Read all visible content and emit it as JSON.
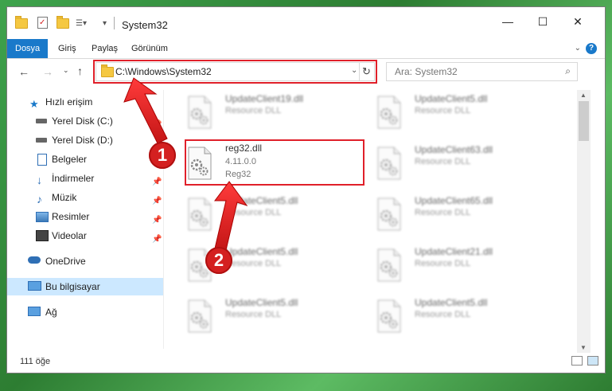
{
  "window": {
    "title": "System32",
    "minimize": "—",
    "maximize": "☐",
    "close": "✕"
  },
  "ribbon": {
    "tabs": [
      "Dosya",
      "Giriş",
      "Paylaş",
      "Görünüm"
    ],
    "help": "?"
  },
  "address": {
    "path": "C:\\Windows\\System32",
    "search_placeholder": "Ara: System32"
  },
  "nav": {
    "items": [
      {
        "label": "Hızlı erişim",
        "icon": "star-icon"
      },
      {
        "label": "Yerel Disk (C:)",
        "icon": "drive-icon"
      },
      {
        "label": "Yerel Disk (D:)",
        "icon": "drive-icon"
      },
      {
        "label": "Belgeler",
        "icon": "documents-icon"
      },
      {
        "label": "İndirmeler",
        "icon": "download-icon"
      },
      {
        "label": "Müzik",
        "icon": "music-icon"
      },
      {
        "label": "Resimler",
        "icon": "pictures-icon"
      },
      {
        "label": "Videolar",
        "icon": "video-icon"
      },
      {
        "label": "OneDrive",
        "icon": "cloud-icon"
      },
      {
        "label": "Bu bilgisayar",
        "icon": "computer-icon"
      },
      {
        "label": "Ağ",
        "icon": "network-icon"
      }
    ]
  },
  "files": {
    "left": [
      {
        "name": "UpdateClient19.dll",
        "type": "Resource DLL"
      },
      {
        "name": "reg32.dll",
        "type": "4.11.0.0",
        "extra": "Reg32"
      },
      {
        "name": "UpdateClient5.dll",
        "type": "Resource DLL"
      },
      {
        "name": "UpdateClient5.dll",
        "type": "Resource DLL"
      },
      {
        "name": "UpdateClient5.dll",
        "type": "Resource DLL"
      }
    ],
    "right": [
      {
        "name": "UpdateClient5.dll",
        "type": "Resource DLL"
      },
      {
        "name": "UpdateClient63.dll",
        "type": "Resource DLL"
      },
      {
        "name": "UpdateClient65.dll",
        "type": "Resource DLL"
      },
      {
        "name": "UpdateClient21.dll",
        "type": "Resource DLL"
      },
      {
        "name": "UpdateClient5.dll",
        "type": "Resource DLL"
      }
    ]
  },
  "status": {
    "count": "111 öğe"
  },
  "badges": [
    "1",
    "2"
  ],
  "colors": {
    "accent": "#1979ca",
    "highlight": "#e0202a",
    "selection": "#cce8ff"
  }
}
